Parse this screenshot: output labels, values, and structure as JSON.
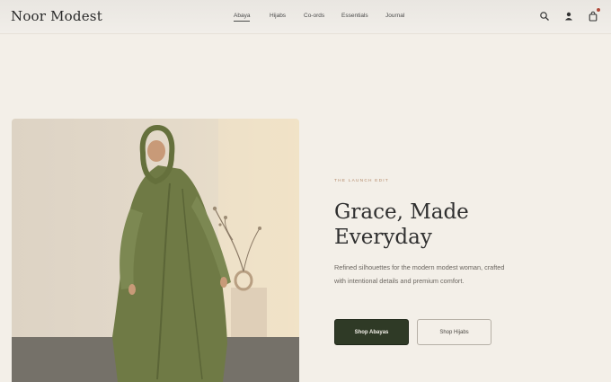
{
  "brand": {
    "name": "Noor Modest"
  },
  "nav": {
    "items": [
      {
        "label": "Abaya",
        "active": true
      },
      {
        "label": "Hijabs",
        "active": false
      },
      {
        "label": "Co-ords",
        "active": false
      },
      {
        "label": "Essentials",
        "active": false
      },
      {
        "label": "Journal",
        "active": false
      }
    ]
  },
  "header_icons": [
    "search-icon",
    "user-icon",
    "bag-icon"
  ],
  "cart": {
    "has_badge": true
  },
  "hero": {
    "eyebrow": "THE LAUNCH EDIT",
    "headline_line1": "Grace, Made",
    "headline_line2": "Everyday",
    "subtext": "Refined silhouettes for the modern modest woman, crafted with intentional details and premium comfort.",
    "primary_cta": "Shop Abayas",
    "secondary_cta": "Shop Hijabs"
  },
  "colors": {
    "background": "#f3efe8",
    "primary_button": "#2f3a26",
    "eyebrow": "#b58a6b",
    "garment": "#6f7a45"
  }
}
